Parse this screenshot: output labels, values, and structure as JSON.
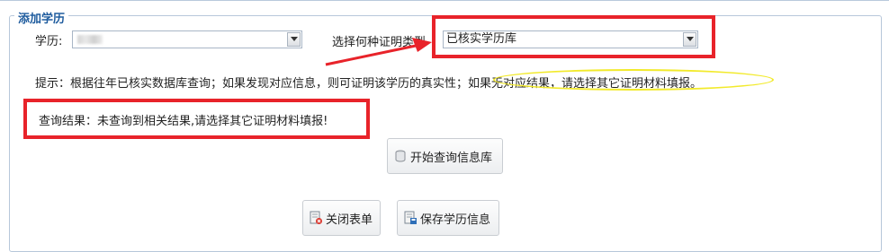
{
  "section": {
    "title": "添加学历"
  },
  "education": {
    "label": "学历:",
    "selected": ""
  },
  "proof_type": {
    "label": "选择何种证明类型",
    "selected": "已核实学历库"
  },
  "hint": {
    "text": "提示：根据往年已核实数据库查询；如果发现对应信息，则可证明该学历的真实性；如果无对应结果，请选择其它证明材料填报。"
  },
  "result": {
    "text": "查询结果：未查询到相关结果,请选择其它证明材料填报!"
  },
  "buttons": {
    "query": "开始查询信息库",
    "close": "关闭表单",
    "save": "保存学历信息"
  },
  "colors": {
    "annotation_red": "#e8232a",
    "annotation_yellow": "#f2ea2b",
    "legend_blue": "#1f5c9e"
  },
  "icons": [
    "chevron-down-icon",
    "database-icon",
    "close-form-icon",
    "save-icon",
    "red-arrow-annotation"
  ]
}
